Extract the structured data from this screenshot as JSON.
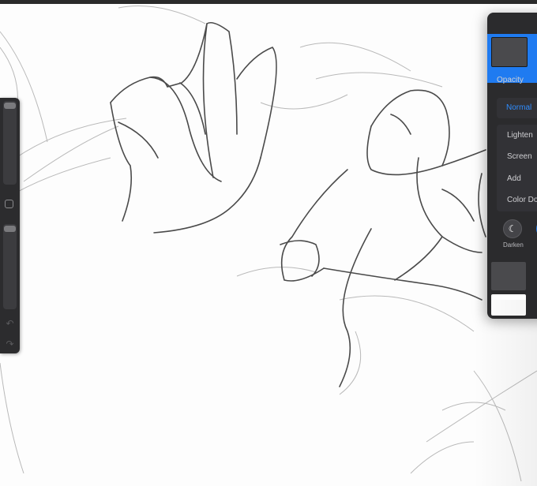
{
  "layers_panel": {
    "opacity_label": "Opacity",
    "blend_mode_selected": "Normal",
    "blend_modes": [
      "Lighten",
      "Screen",
      "Add",
      "Color Do"
    ],
    "mode_group_label": "Darken",
    "darken_icon": "moon-icon",
    "accent_color": "#1f7bf1"
  },
  "sidebar": {
    "icons": [
      "brush-size-slider",
      "modify-button",
      "opacity-slider",
      "undo-icon",
      "redo-icon"
    ]
  }
}
